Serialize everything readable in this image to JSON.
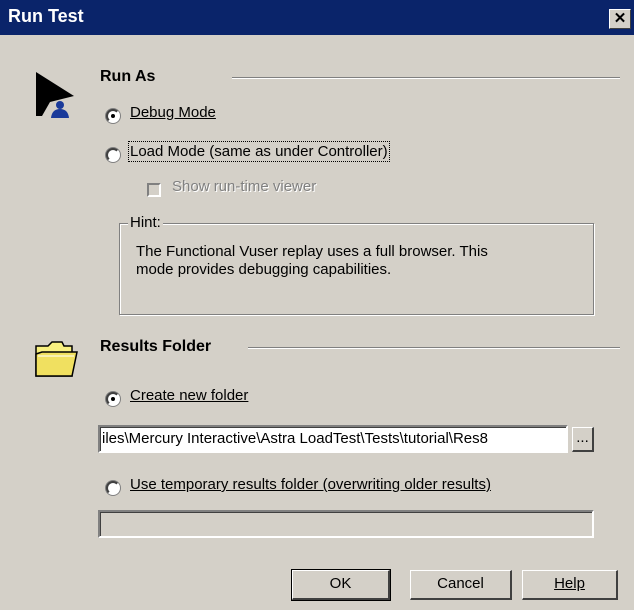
{
  "window": {
    "title": "Run Test",
    "close_glyph": "✕"
  },
  "run_as": {
    "title": "Run As",
    "icon": "run-vuser-icon",
    "debug_mode_label": "Debug Mode",
    "debug_mode_selected": true,
    "load_mode_label": "Load Mode (same as under Controller)",
    "load_mode_selected": false,
    "show_viewer_label": "Show run-time viewer",
    "show_viewer_checked": false,
    "show_viewer_enabled": false
  },
  "hint": {
    "legend": "Hint:",
    "line1": "The Functional Vuser replay uses a full browser. This",
    "line2": "mode provides debugging capabilities."
  },
  "results": {
    "title": "Results Folder",
    "icon": "folder-icon",
    "create_new_label": "Create new folder",
    "create_new_selected": true,
    "path_value": "iles\\Mercury Interactive\\Astra LoadTest\\Tests\\tutorial\\Res8",
    "browse_label": "...",
    "use_temp_label": "Use temporary results folder (overwriting older results)",
    "use_temp_selected": false,
    "temp_value": ""
  },
  "buttons": {
    "ok": "OK",
    "cancel": "Cancel",
    "help": "Help"
  },
  "colors": {
    "titlebar": "#0a246a",
    "dialog_bg": "#d4d0c8",
    "folder_yellow": "#f8f080"
  }
}
